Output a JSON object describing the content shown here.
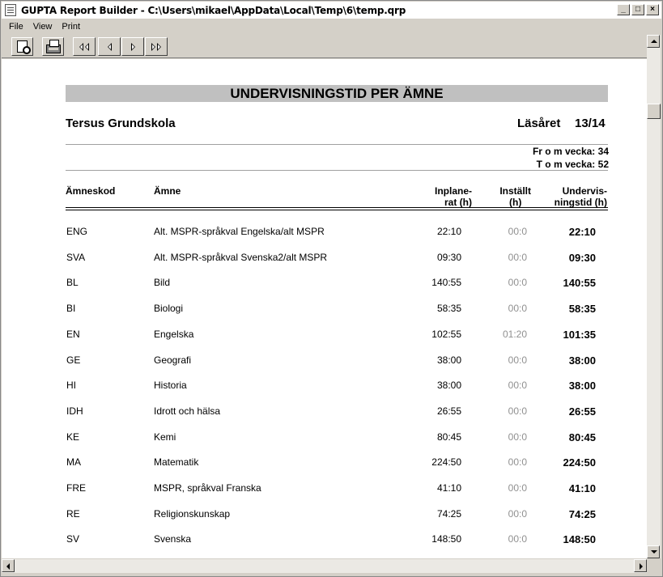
{
  "window": {
    "title": "GUPTA Report Builder - C:\\Users\\mikael\\AppData\\Local\\Temp\\6\\temp.qrp"
  },
  "menu": [
    "File",
    "View",
    "Print"
  ],
  "toolbar": {
    "buttons": [
      "preview-icon",
      "printer-icon",
      "first-page-icon",
      "previous-page-icon",
      "next-page-icon",
      "last-page-icon"
    ]
  },
  "report": {
    "title": "UNDERVISNINGSTID PER ÄMNE",
    "school": "Tersus Grundskola",
    "year_label": "Läsåret",
    "year_value": "13/14",
    "from_week": "Fr o m vecka: 34",
    "to_week": "T o m vecka: 52",
    "columns": {
      "code": "Ämneskod",
      "name": "Ämne",
      "planned_1": "Inplane-",
      "planned_2": "rat (h)",
      "cancelled_1": "Inställt",
      "cancelled_2": "(h)",
      "teaching_1": "Undervis-",
      "teaching_2": "ningstid (h)"
    },
    "rows": [
      {
        "code": "ENG",
        "name": "Alt. MSPR-språkval Engelska/alt MSPR",
        "planned": "22:10",
        "cancelled": "00:0",
        "teaching": "22:10"
      },
      {
        "code": "SVA",
        "name": "Alt. MSPR-språkval Svenska2/alt MSPR",
        "planned": "09:30",
        "cancelled": "00:0",
        "teaching": "09:30"
      },
      {
        "code": "BL",
        "name": "Bild",
        "planned": "140:55",
        "cancelled": "00:0",
        "teaching": "140:55"
      },
      {
        "code": "BI",
        "name": "Biologi",
        "planned": "58:35",
        "cancelled": "00:0",
        "teaching": "58:35"
      },
      {
        "code": "EN",
        "name": "Engelska",
        "planned": "102:55",
        "cancelled": "01:20",
        "teaching": "101:35"
      },
      {
        "code": "GE",
        "name": "Geografi",
        "planned": "38:00",
        "cancelled": "00:0",
        "teaching": "38:00"
      },
      {
        "code": "HI",
        "name": "Historia",
        "planned": "38:00",
        "cancelled": "00:0",
        "teaching": "38:00"
      },
      {
        "code": "IDH",
        "name": "Idrott och hälsa",
        "planned": "26:55",
        "cancelled": "00:0",
        "teaching": "26:55"
      },
      {
        "code": "KE",
        "name": "Kemi",
        "planned": "80:45",
        "cancelled": "00:0",
        "teaching": "80:45"
      },
      {
        "code": "MA",
        "name": "Matematik",
        "planned": "224:50",
        "cancelled": "00:0",
        "teaching": "224:50"
      },
      {
        "code": "FRE",
        "name": "MSPR, språkval Franska",
        "planned": "41:10",
        "cancelled": "00:0",
        "teaching": "41:10"
      },
      {
        "code": "RE",
        "name": "Religionskunskap",
        "planned": "74:25",
        "cancelled": "00:0",
        "teaching": "74:25"
      },
      {
        "code": "SV",
        "name": "Svenska",
        "planned": "148:50",
        "cancelled": "00:0",
        "teaching": "148:50"
      }
    ]
  }
}
